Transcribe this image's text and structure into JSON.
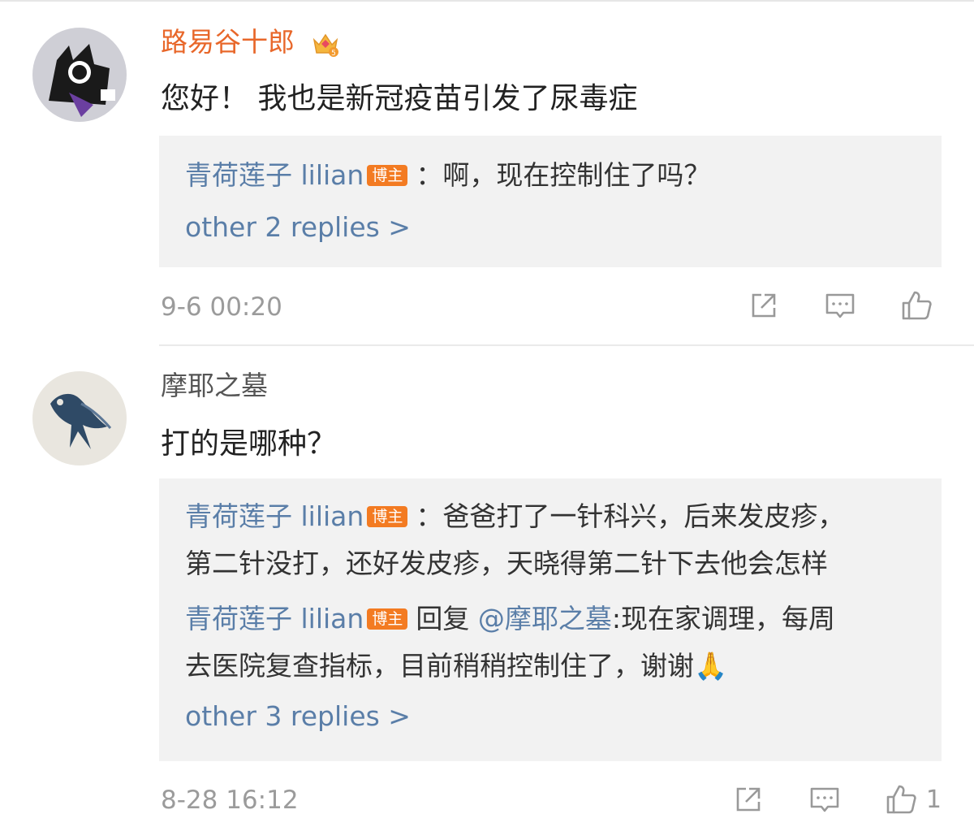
{
  "comments": [
    {
      "username": "路易谷十郎",
      "badge": "crown-vip-badge",
      "text": "您好！ 我也是新冠疫苗引发了尿毒症",
      "replies": [
        {
          "name": "青荷莲子 lilian",
          "tag": "博主",
          "prefix": "",
          "mention": "",
          "sep": "：",
          "text": "啊，现在控制住了吗？"
        }
      ],
      "more": "other 2 replies >",
      "time": "9-6 00:20",
      "like_count": ""
    },
    {
      "username": "摩耶之墓",
      "text": "打的是哪种？",
      "replies": [
        {
          "name": "青荷莲子 lilian",
          "tag": "博主",
          "prefix": "",
          "mention": "",
          "sep": "：",
          "text": "爸爸打了一针科兴，后来发皮疹，",
          "text2": "第二针没打，还好发皮疹，天晓得第二针下去他会怎样"
        },
        {
          "name": "青荷莲子 lilian",
          "tag": "博主",
          "prefix": "回复 ",
          "mention": "@摩耶之墓",
          "sep": ":",
          "text": "现在家调理，每周",
          "text2": "去医院复查指标，目前稍稍控制住了，谢谢🙏"
        }
      ],
      "more": "other 3 replies >",
      "time": "8-28 16:12",
      "like_count": "1"
    }
  ],
  "colors": {
    "username_vip": "#e8672a",
    "link": "#5a7ea8",
    "tag_bg": "#f37b22",
    "reply_bg": "#f2f2f2"
  }
}
